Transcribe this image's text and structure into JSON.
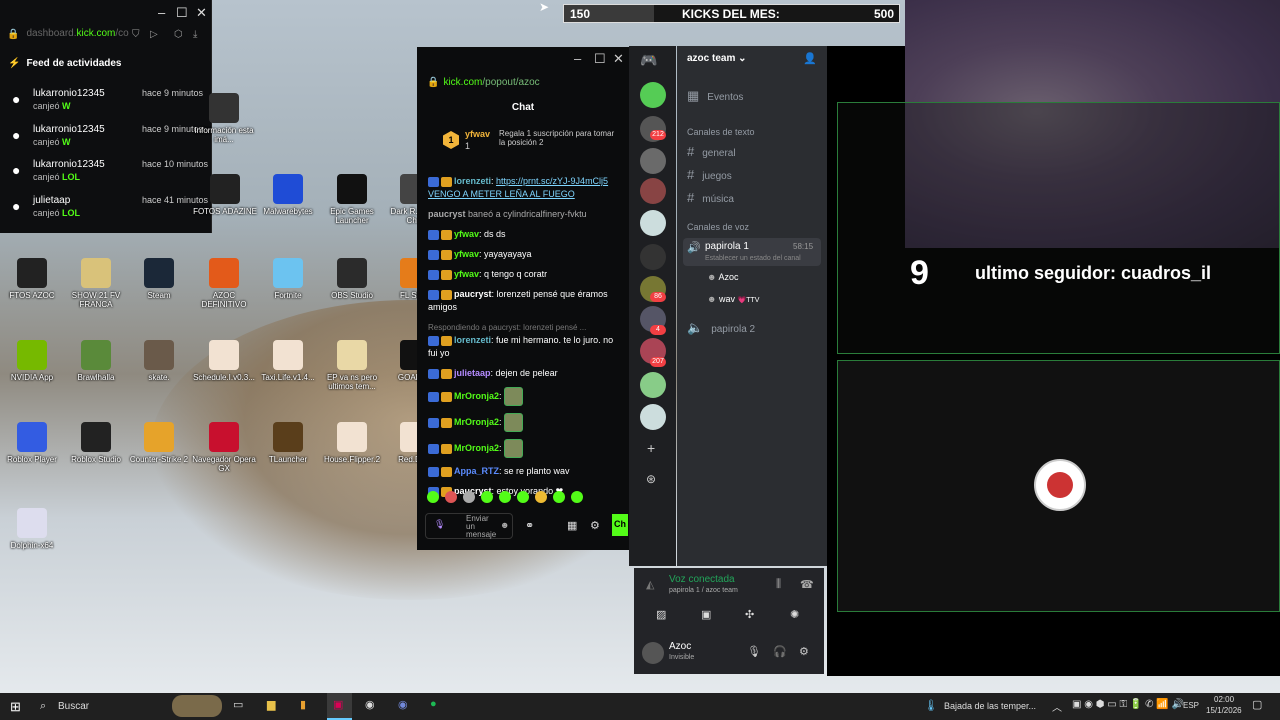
{
  "activity_window": {
    "url_prefix": "dashboard.",
    "url": "kick.com",
    "url_suffix": "/co",
    "title": "Feed de actividades",
    "items": [
      {
        "user": "lukarronio12345",
        "action": "canjeó",
        "reward": "W",
        "time": "hace 9 minutos"
      },
      {
        "user": "lukarronio12345",
        "action": "canjeó",
        "reward": "W",
        "time": "hace 9 minutos"
      },
      {
        "user": "lukarronio12345",
        "action": "canjeó",
        "reward": "LOL",
        "time": "hace 10 minutos"
      },
      {
        "user": "julietaap",
        "action": "canjeó",
        "reward": "LOL",
        "time": "hace 41 minutos"
      }
    ]
  },
  "desktop_icons": [
    {
      "label": "Información esta imá...",
      "color": "#333"
    },
    {
      "label": "FOTOS ADAZINE",
      "color": "#222"
    },
    {
      "label": "Malwarebytes",
      "color": "#1f4cd6"
    },
    {
      "label": "Epic Games Launcher",
      "color": "#111"
    },
    {
      "label": "Dark R... Kick Ch...",
      "color": "#444"
    },
    {
      "label": "FTOS AZOC",
      "color": "#222"
    },
    {
      "label": "SHOW 21 FV FRANCA",
      "color": "#d9c27a"
    },
    {
      "label": "Steam",
      "color": "#1b2838"
    },
    {
      "label": "AZOC DEFINITIVO",
      "color": "#e35a1a"
    },
    {
      "label": "Fortnite",
      "color": "#6cc3f0"
    },
    {
      "label": "OBS Studio",
      "color": "#2b2b2b"
    },
    {
      "label": "FL Stu...",
      "color": "#e57c1a"
    },
    {
      "label": "NVIDIA App",
      "color": "#76b900"
    },
    {
      "label": "Brawlhalla",
      "color": "#5a8a3a"
    },
    {
      "label": "skate.",
      "color": "#6a5a4a"
    },
    {
      "label": "Schedule.I.v0.3...",
      "color": "#f2e2d2"
    },
    {
      "label": "Taxi.Life.v1.4...",
      "color": "#f2e2d2"
    },
    {
      "label": "EP va ns pero ultimos tem...",
      "color": "#e9d8a6"
    },
    {
      "label": "GOALS...",
      "color": "#111"
    },
    {
      "label": "Roblox Player",
      "color": "#335ce2"
    },
    {
      "label": "Roblox Studio",
      "color": "#222"
    },
    {
      "label": "Counter-Strike 2",
      "color": "#e6a32a"
    },
    {
      "label": "Navegador Opera GX",
      "color": "#c8102e"
    },
    {
      "label": "TLauncher",
      "color": "#5a3e1b"
    },
    {
      "label": "House.Flipper.2",
      "color": "#f2e2d2"
    },
    {
      "label": "Red.De...",
      "color": "#f2e2d2"
    },
    {
      "label": "Dolphin-x64",
      "color": "#dde"
    }
  ],
  "chat_window": {
    "url": "kick.com",
    "url_suffix": "/popout/azoc",
    "title": "Chat",
    "gift": {
      "rank": "1",
      "user": "yfwav",
      "count": "1",
      "text": "Regala 1 suscripción para tomar la posición 2"
    },
    "messages": [
      {
        "user": "lorenzeti",
        "text": "https://prnt.sc/zYJ-9J4mClj5 VENGO A METER LEÑA AL FUEGO",
        "color": "#6bc",
        "link": true
      },
      {
        "user": "paucryst",
        "text": "baneó a cylindricalfinery-fvktu",
        "color": "#aaa",
        "system": true
      },
      {
        "user": "yfwav",
        "text": "ds ds",
        "color": "#53fc18"
      },
      {
        "user": "yfwav",
        "text": "yayayayaya",
        "color": "#53fc18"
      },
      {
        "user": "yfwav",
        "text": "q tengo q coratr",
        "color": "#53fc18"
      },
      {
        "user": "paucryst",
        "text": "lorenzeti pensé que éramos amigos",
        "color": "#fff"
      },
      {
        "user": "lorenzeti",
        "text": "fue mi hermano. te lo juro. no fui yo",
        "color": "#6bc",
        "reply": "Respondiendo a paucryst: lorenzeti pensé ..."
      },
      {
        "user": "julietaap",
        "text": "dejen de pelear",
        "color": "#b58cff"
      },
      {
        "user": "MrOronja2",
        "text": "",
        "color": "#53fc18",
        "emote": true
      },
      {
        "user": "MrOronja2",
        "text": "",
        "color": "#53fc18",
        "emote": true
      },
      {
        "user": "MrOronja2",
        "text": "",
        "color": "#53fc18",
        "emote": true
      },
      {
        "user": "Appa_RTZ",
        "text": "se re planto wav",
        "color": "#5b8cff"
      },
      {
        "user": "paucryst",
        "text": "estoy yorando ❤",
        "color": "#fff"
      }
    ],
    "input_placeholder": "Enviar un mensaje",
    "send": "Ch"
  },
  "discord": {
    "server": "azoc team",
    "events": "Eventos",
    "text_group": "Canales de texto",
    "text_channels": [
      "general",
      "juegos",
      "música"
    ],
    "voice_group": "Canales de voz",
    "voice_channel": "papirola 1",
    "voice_timer": "58:15",
    "voice_status": "Establecer un estado del canal",
    "voice_users": [
      "Azoc",
      "wav"
    ],
    "wav_tag": "💗TTV",
    "voice_channel2": "papirola 2",
    "badges": [
      "212",
      "86",
      "4",
      "207"
    ],
    "connected": "Voz conectada",
    "connected_sub": "papirola 1 / azoc team",
    "user": "Azoc",
    "user_status": "Invisible"
  },
  "overlay": {
    "kicks_min": "150",
    "kicks_label": "KICKS DEL MES:",
    "kicks_max": "500",
    "kicks_progress": 0.27,
    "follower_prefix": "9",
    "follower_text": "ultimo seguidor: cuadros_il"
  },
  "taskbar": {
    "search": "Buscar",
    "weather": "Bajada de las temper...",
    "lang": "ESP",
    "time": "02:00",
    "date": "15/1/2026"
  }
}
